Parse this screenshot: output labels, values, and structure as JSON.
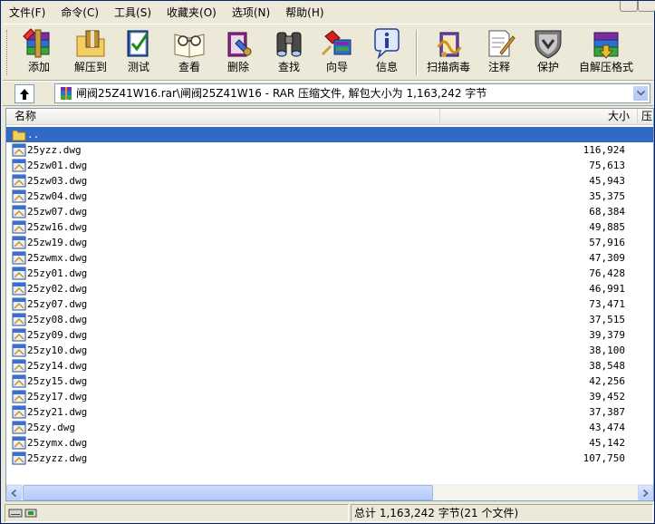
{
  "menu": [
    {
      "label": "文件(F)"
    },
    {
      "label": "命令(C)"
    },
    {
      "label": "工具(S)"
    },
    {
      "label": "收藏夹(O)"
    },
    {
      "label": "选项(N)"
    },
    {
      "label": "帮助(H)"
    }
  ],
  "toolbar": {
    "add": "添加",
    "extract_to": "解压到",
    "test": "测试",
    "view": "查看",
    "delete": "删除",
    "find": "查找",
    "wizard": "向导",
    "info": "信息",
    "virus_scan": "扫描病毒",
    "comment": "注释",
    "protect": "保护",
    "sfx": "自解压格式"
  },
  "address": {
    "text": "闸阀25Z41W16.rar\\闸阀25Z41W16 - RAR 压缩文件, 解包大小为 1,163,242 字节"
  },
  "columns": {
    "name": "名称",
    "size": "大小",
    "packed": "压"
  },
  "files": [
    {
      "name": "..",
      "size": ""
    },
    {
      "name": "25yzz.dwg",
      "size": "116,924"
    },
    {
      "name": "25zw01.dwg",
      "size": "75,613"
    },
    {
      "name": "25zw03.dwg",
      "size": "45,943"
    },
    {
      "name": "25zw04.dwg",
      "size": "35,375"
    },
    {
      "name": "25zw07.dwg",
      "size": "68,384"
    },
    {
      "name": "25zw16.dwg",
      "size": "49,885"
    },
    {
      "name": "25zw19.dwg",
      "size": "57,916"
    },
    {
      "name": "25zwmx.dwg",
      "size": "47,309"
    },
    {
      "name": "25zy01.dwg",
      "size": "76,428"
    },
    {
      "name": "25zy02.dwg",
      "size": "46,991"
    },
    {
      "name": "25zy07.dwg",
      "size": "73,471"
    },
    {
      "name": "25zy08.dwg",
      "size": "37,515"
    },
    {
      "name": "25zy09.dwg",
      "size": "39,379"
    },
    {
      "name": "25zy10.dwg",
      "size": "38,100"
    },
    {
      "name": "25zy14.dwg",
      "size": "38,548"
    },
    {
      "name": "25zy15.dwg",
      "size": "42,256"
    },
    {
      "name": "25zy17.dwg",
      "size": "39,452"
    },
    {
      "name": "25zy21.dwg",
      "size": "37,387"
    },
    {
      "name": "25zy.dwg",
      "size": "43,474"
    },
    {
      "name": "25zymx.dwg",
      "size": "45,142"
    },
    {
      "name": "25zyzz.dwg",
      "size": "107,750"
    }
  ],
  "status": {
    "total": "总计 1,163,242 字节(21 个文件)"
  },
  "colors": {
    "selection": "#316ac5",
    "window_border": "#0a246a",
    "face": "#ece9d8"
  }
}
